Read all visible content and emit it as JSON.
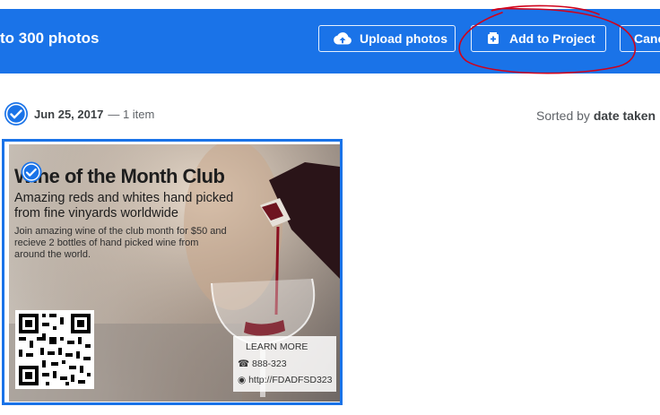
{
  "header": {
    "title": "to 300 photos",
    "upload_label": "Upload photos",
    "add_label": "Add to Project",
    "cancel_label": "Cancel",
    "upload_icon": "cloud-upload-icon",
    "add_icon": "add-to-project-icon"
  },
  "group": {
    "date": "Jun 25, 2017",
    "count": "— 1 item",
    "sorted_prefix": "Sorted by",
    "sorted_value": "date taken"
  },
  "photo": {
    "title": "Wine of the Month Club",
    "subtitle": "Amazing reds and whites hand picked from fine vinyards worldwide",
    "body": "Join amazing wine of the club month for $50 and recieve 2 bottles of hand picked wine from around the world.",
    "learn_more": "LEARN MORE",
    "phone": "888-323",
    "url": "http://FDADFSD323"
  },
  "colors": {
    "accent": "#1a73e8",
    "annotation": "#d0021b"
  }
}
